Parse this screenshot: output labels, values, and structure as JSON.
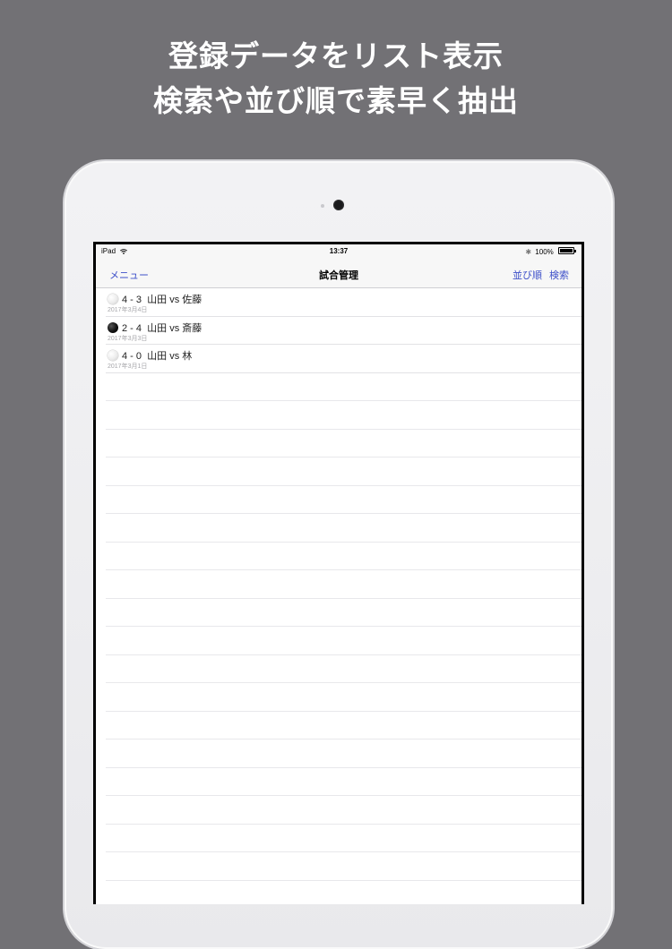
{
  "promo": {
    "line1": "登録データをリスト表示",
    "line2": "検索や並び順で素早く抽出"
  },
  "status_bar": {
    "device": "iPad",
    "time": "13:37",
    "battery": "100%"
  },
  "nav": {
    "menu_label": "メニュー",
    "title": "試合管理",
    "sort_label": "並び順",
    "search_label": "検索"
  },
  "games": [
    {
      "result_icon": "white-ball-icon",
      "score": "4 - 3",
      "teams": "山田 vs 佐藤",
      "date": "2017年3月4日"
    },
    {
      "result_icon": "black-ball-icon",
      "score": "2 - 4",
      "teams": "山田 vs 斎藤",
      "date": "2017年3月3日"
    },
    {
      "result_icon": "white-ball-icon",
      "score": "4 - 0",
      "teams": "山田 vs 林",
      "date": "2017年3月1日"
    }
  ],
  "colors": {
    "background": "#727175",
    "nav_link": "#3f51c9",
    "device_frame": "#f2f2f4"
  }
}
